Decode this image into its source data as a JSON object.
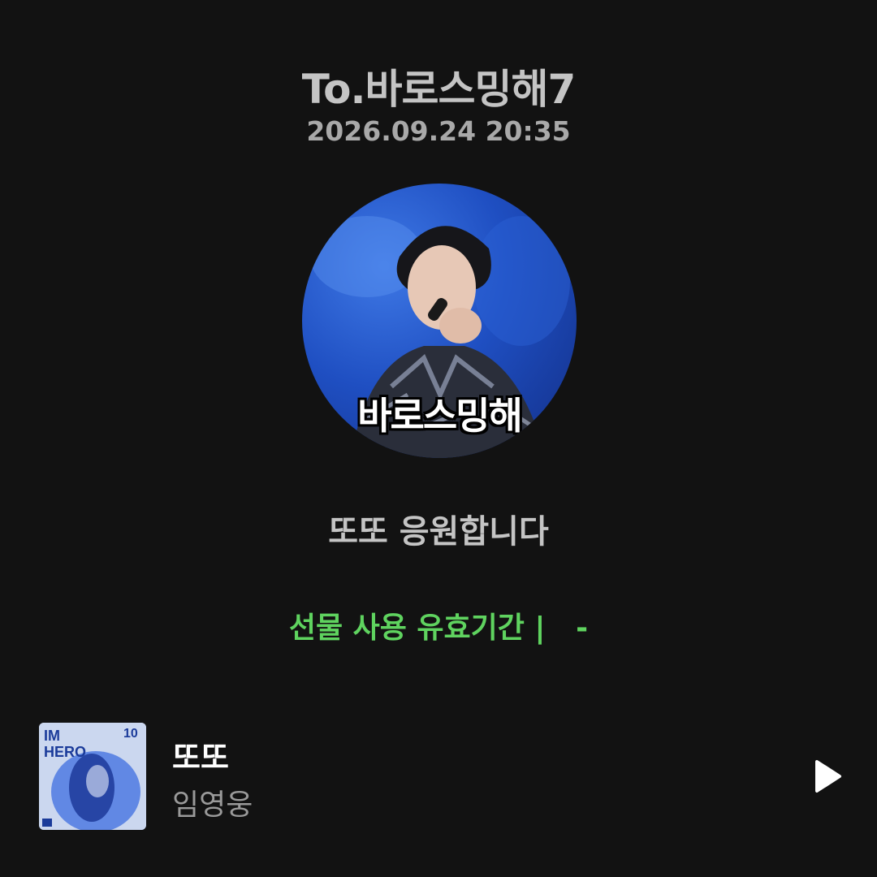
{
  "header": {
    "recipient": "To.바로스밍해7",
    "timestamp": "2026.09.24 20:35"
  },
  "avatar": {
    "caption": "바로스밍해"
  },
  "message": "또또 응원합니다",
  "gift": {
    "validity": "선물 사용 유효기간 |   -"
  },
  "song": {
    "title": "또또",
    "artist": "임영웅",
    "album_art_text": "IM HERO",
    "play_icon": "play-icon"
  },
  "colors": {
    "background": "#121212",
    "accent_green": "#5fd35f",
    "text_primary": "#ffffff",
    "text_secondary": "#9a9a9a"
  }
}
